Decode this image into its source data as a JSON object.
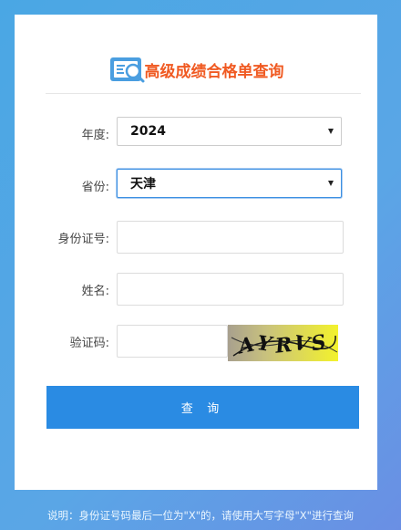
{
  "header": {
    "title": "高级成绩合格单查询",
    "logo_icon": "search-document-icon"
  },
  "form": {
    "year": {
      "label": "年度:",
      "value": "2024"
    },
    "province": {
      "label": "省份:",
      "value": "天津"
    },
    "id_number": {
      "label": "身份证号:",
      "value": "",
      "placeholder": ""
    },
    "name": {
      "label": "姓名:",
      "value": "",
      "placeholder": ""
    },
    "captcha": {
      "label": "验证码:",
      "value": "",
      "placeholder": "",
      "image_text": "AYRVS"
    }
  },
  "submit": {
    "label": "查 询"
  },
  "footer": {
    "note": "说明：身份证号码最后一位为\"X\"的，请使用大写字母\"X\"进行查询"
  },
  "colors": {
    "background": "#4aa7e4",
    "title": "#f05a22",
    "button": "#2a8be3",
    "focus_border": "#3b8fe2"
  }
}
